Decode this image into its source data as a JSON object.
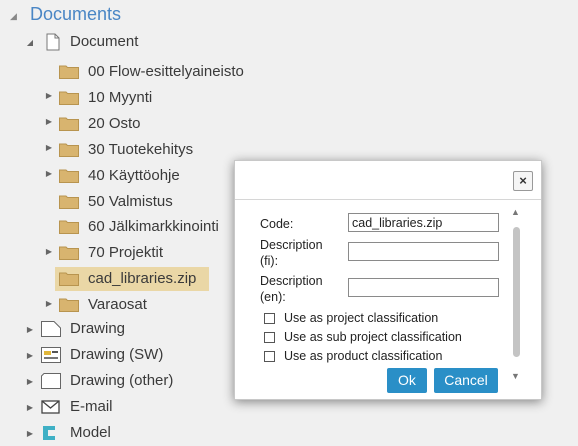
{
  "tree": {
    "root_label": "Documents",
    "document_label": "Document",
    "folders": [
      {
        "label": "00 Flow-esittelyaineisto",
        "expandable": false
      },
      {
        "label": "10 Myynti",
        "expandable": true
      },
      {
        "label": "20 Osto",
        "expandable": true
      },
      {
        "label": "30 Tuotekehitys",
        "expandable": true
      },
      {
        "label": "40 Käyttöohje",
        "expandable": true
      },
      {
        "label": "50 Valmistus",
        "expandable": false
      },
      {
        "label": "60 Jälkimarkkinointi",
        "expandable": false
      },
      {
        "label": "70 Projektit",
        "expandable": true
      },
      {
        "label": "cad_libraries.zip",
        "expandable": false,
        "selected": true
      },
      {
        "label": "Varaosat",
        "expandable": true
      }
    ],
    "types": [
      {
        "label": "Drawing",
        "icon": "drawing-icon"
      },
      {
        "label": "Drawing (SW)",
        "icon": "drawing-sw-icon"
      },
      {
        "label": "Drawing (other)",
        "icon": "drawing-other-icon"
      },
      {
        "label": "E-mail",
        "icon": "email-icon"
      },
      {
        "label": "Model",
        "icon": "model-icon"
      }
    ]
  },
  "dialog": {
    "code_label": "Code:",
    "code_value": "cad_libraries.zip",
    "desc_fi_label_1": "Description",
    "desc_fi_label_2": "(fi):",
    "desc_fi_value": "",
    "desc_en_label_1": "Description",
    "desc_en_label_2": "(en):",
    "desc_en_value": "",
    "checkbox_project": "Use as project classification",
    "checkbox_subproject": "Use as sub project classification",
    "checkbox_product": "Use as product classification",
    "ok_label": "Ok",
    "cancel_label": "Cancel",
    "close_glyph": "×"
  },
  "colors": {
    "accent": "#2a8fc7",
    "root_link": "#4a86c5",
    "selected": "#ead7a6",
    "folder": "#d8b46f"
  }
}
